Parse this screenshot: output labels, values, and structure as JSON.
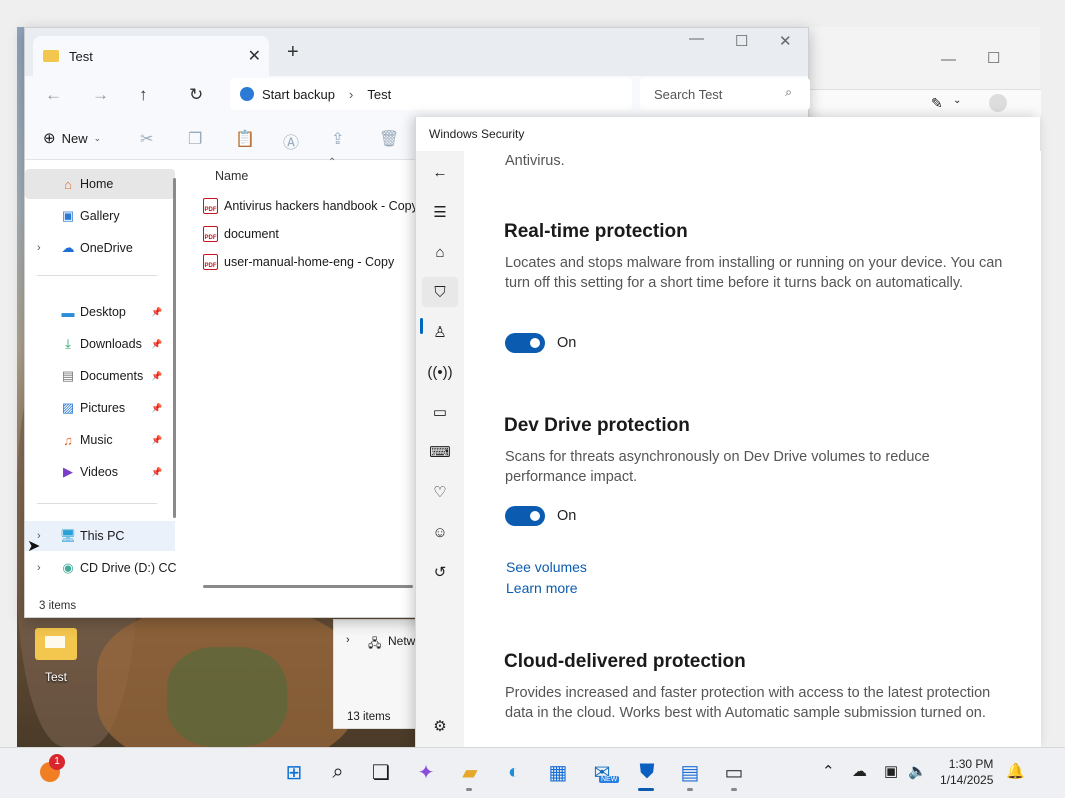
{
  "explorer": {
    "tab_title": "Test",
    "breadcrumb": [
      "Start backup",
      "Test"
    ],
    "search_placeholder": "Search Test",
    "new_label": "New",
    "column_name": "Name",
    "sidebar": [
      {
        "label": "Home",
        "icon": "home-icon"
      },
      {
        "label": "Gallery",
        "icon": "gallery-icon"
      },
      {
        "label": "OneDrive",
        "icon": "cloud-icon"
      },
      {
        "label": "Desktop",
        "icon": "desktop-icon"
      },
      {
        "label": "Downloads",
        "icon": "download-icon"
      },
      {
        "label": "Documents",
        "icon": "documents-icon"
      },
      {
        "label": "Pictures",
        "icon": "pictures-icon"
      },
      {
        "label": "Music",
        "icon": "music-icon"
      },
      {
        "label": "Videos",
        "icon": "videos-icon"
      },
      {
        "label": "This PC",
        "icon": "pc-icon"
      },
      {
        "label": "CD Drive (D:) CC",
        "icon": "cd-drive-icon"
      }
    ],
    "files": [
      "Antivirus hackers handbook - Copy (",
      "document",
      "user-manual-home-eng - Copy"
    ],
    "status": "3 items"
  },
  "background_window": {
    "label": "Netw",
    "status": "13 items"
  },
  "desktop_icon": {
    "label": "Test"
  },
  "security": {
    "title": "Windows Security",
    "intro_fragment": "Antivirus.",
    "sections": [
      {
        "heading": "Real-time protection",
        "text": "Locates and stops malware from installing or running on your device. You can turn off this setting for a short time before it turns back on automatically.",
        "toggle": "On"
      },
      {
        "heading": "Dev Drive protection",
        "text": "Scans for threats asynchronously on Dev Drive volumes to reduce performance impact.",
        "toggle": "On"
      },
      {
        "heading": "Cloud-delivered protection",
        "text": "Provides increased and faster protection with access to the latest protection data in the cloud. Works best with Automatic sample submission turned on."
      }
    ],
    "links": [
      "See volumes",
      "Learn more"
    ]
  },
  "taskbar": {
    "time": "1:30 PM",
    "date": "1/14/2025",
    "badge": "1",
    "outlook_badge": "NEW"
  },
  "colors": {
    "accent": "#0b5cb0",
    "pdf_red": "#c4161c"
  }
}
